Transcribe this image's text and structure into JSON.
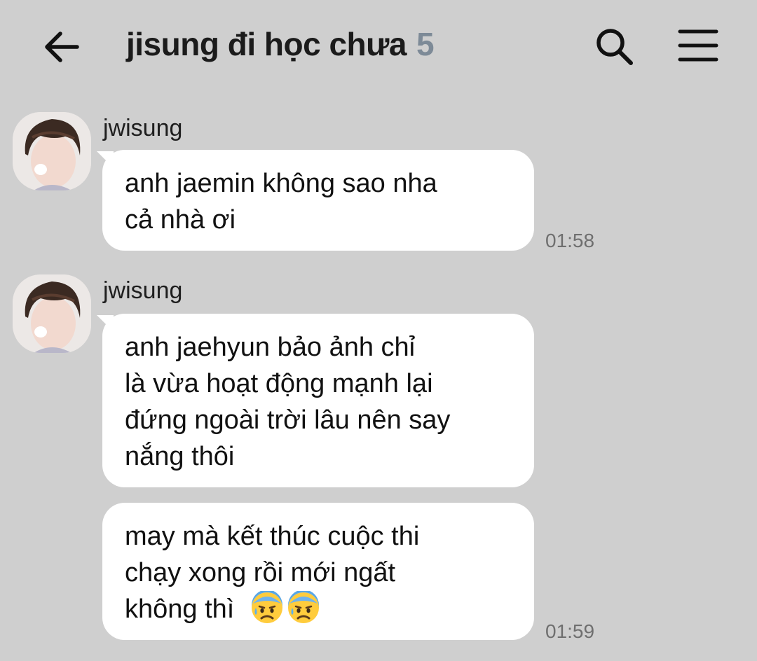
{
  "header": {
    "back_icon": "arrow-left-icon",
    "title": "jisung đi học chưa",
    "member_count": "5",
    "search_icon": "search-icon",
    "menu_icon": "hamburger-menu-icon"
  },
  "messages": [
    {
      "sender": "jwisung",
      "avatar": "avatar-photo",
      "lines": [
        "anh jaemin không sao nha",
        "cả nhà ơi"
      ],
      "time": "01:58"
    },
    {
      "sender": "jwisung",
      "avatar": "avatar-photo",
      "lines": [
        "anh jaehyun bảo ảnh chỉ",
        "là vừa hoạt động mạnh lại",
        "đứng ngoài trời lâu nên say",
        "nắng thôi"
      ],
      "time": ""
    },
    {
      "sender": "",
      "lines": [
        "may mà kết thúc cuộc thi",
        "chạy xong rồi mới ngất",
        "không thì"
      ],
      "emojis": [
        "anxious-face-with-sweat-emoji",
        "anxious-face-with-sweat-emoji"
      ],
      "time": "01:59"
    }
  ],
  "colors": {
    "background": "#cfcfcf",
    "bubble": "#ffffff",
    "count": "#7d8a97",
    "time": "#6f6f6f"
  }
}
